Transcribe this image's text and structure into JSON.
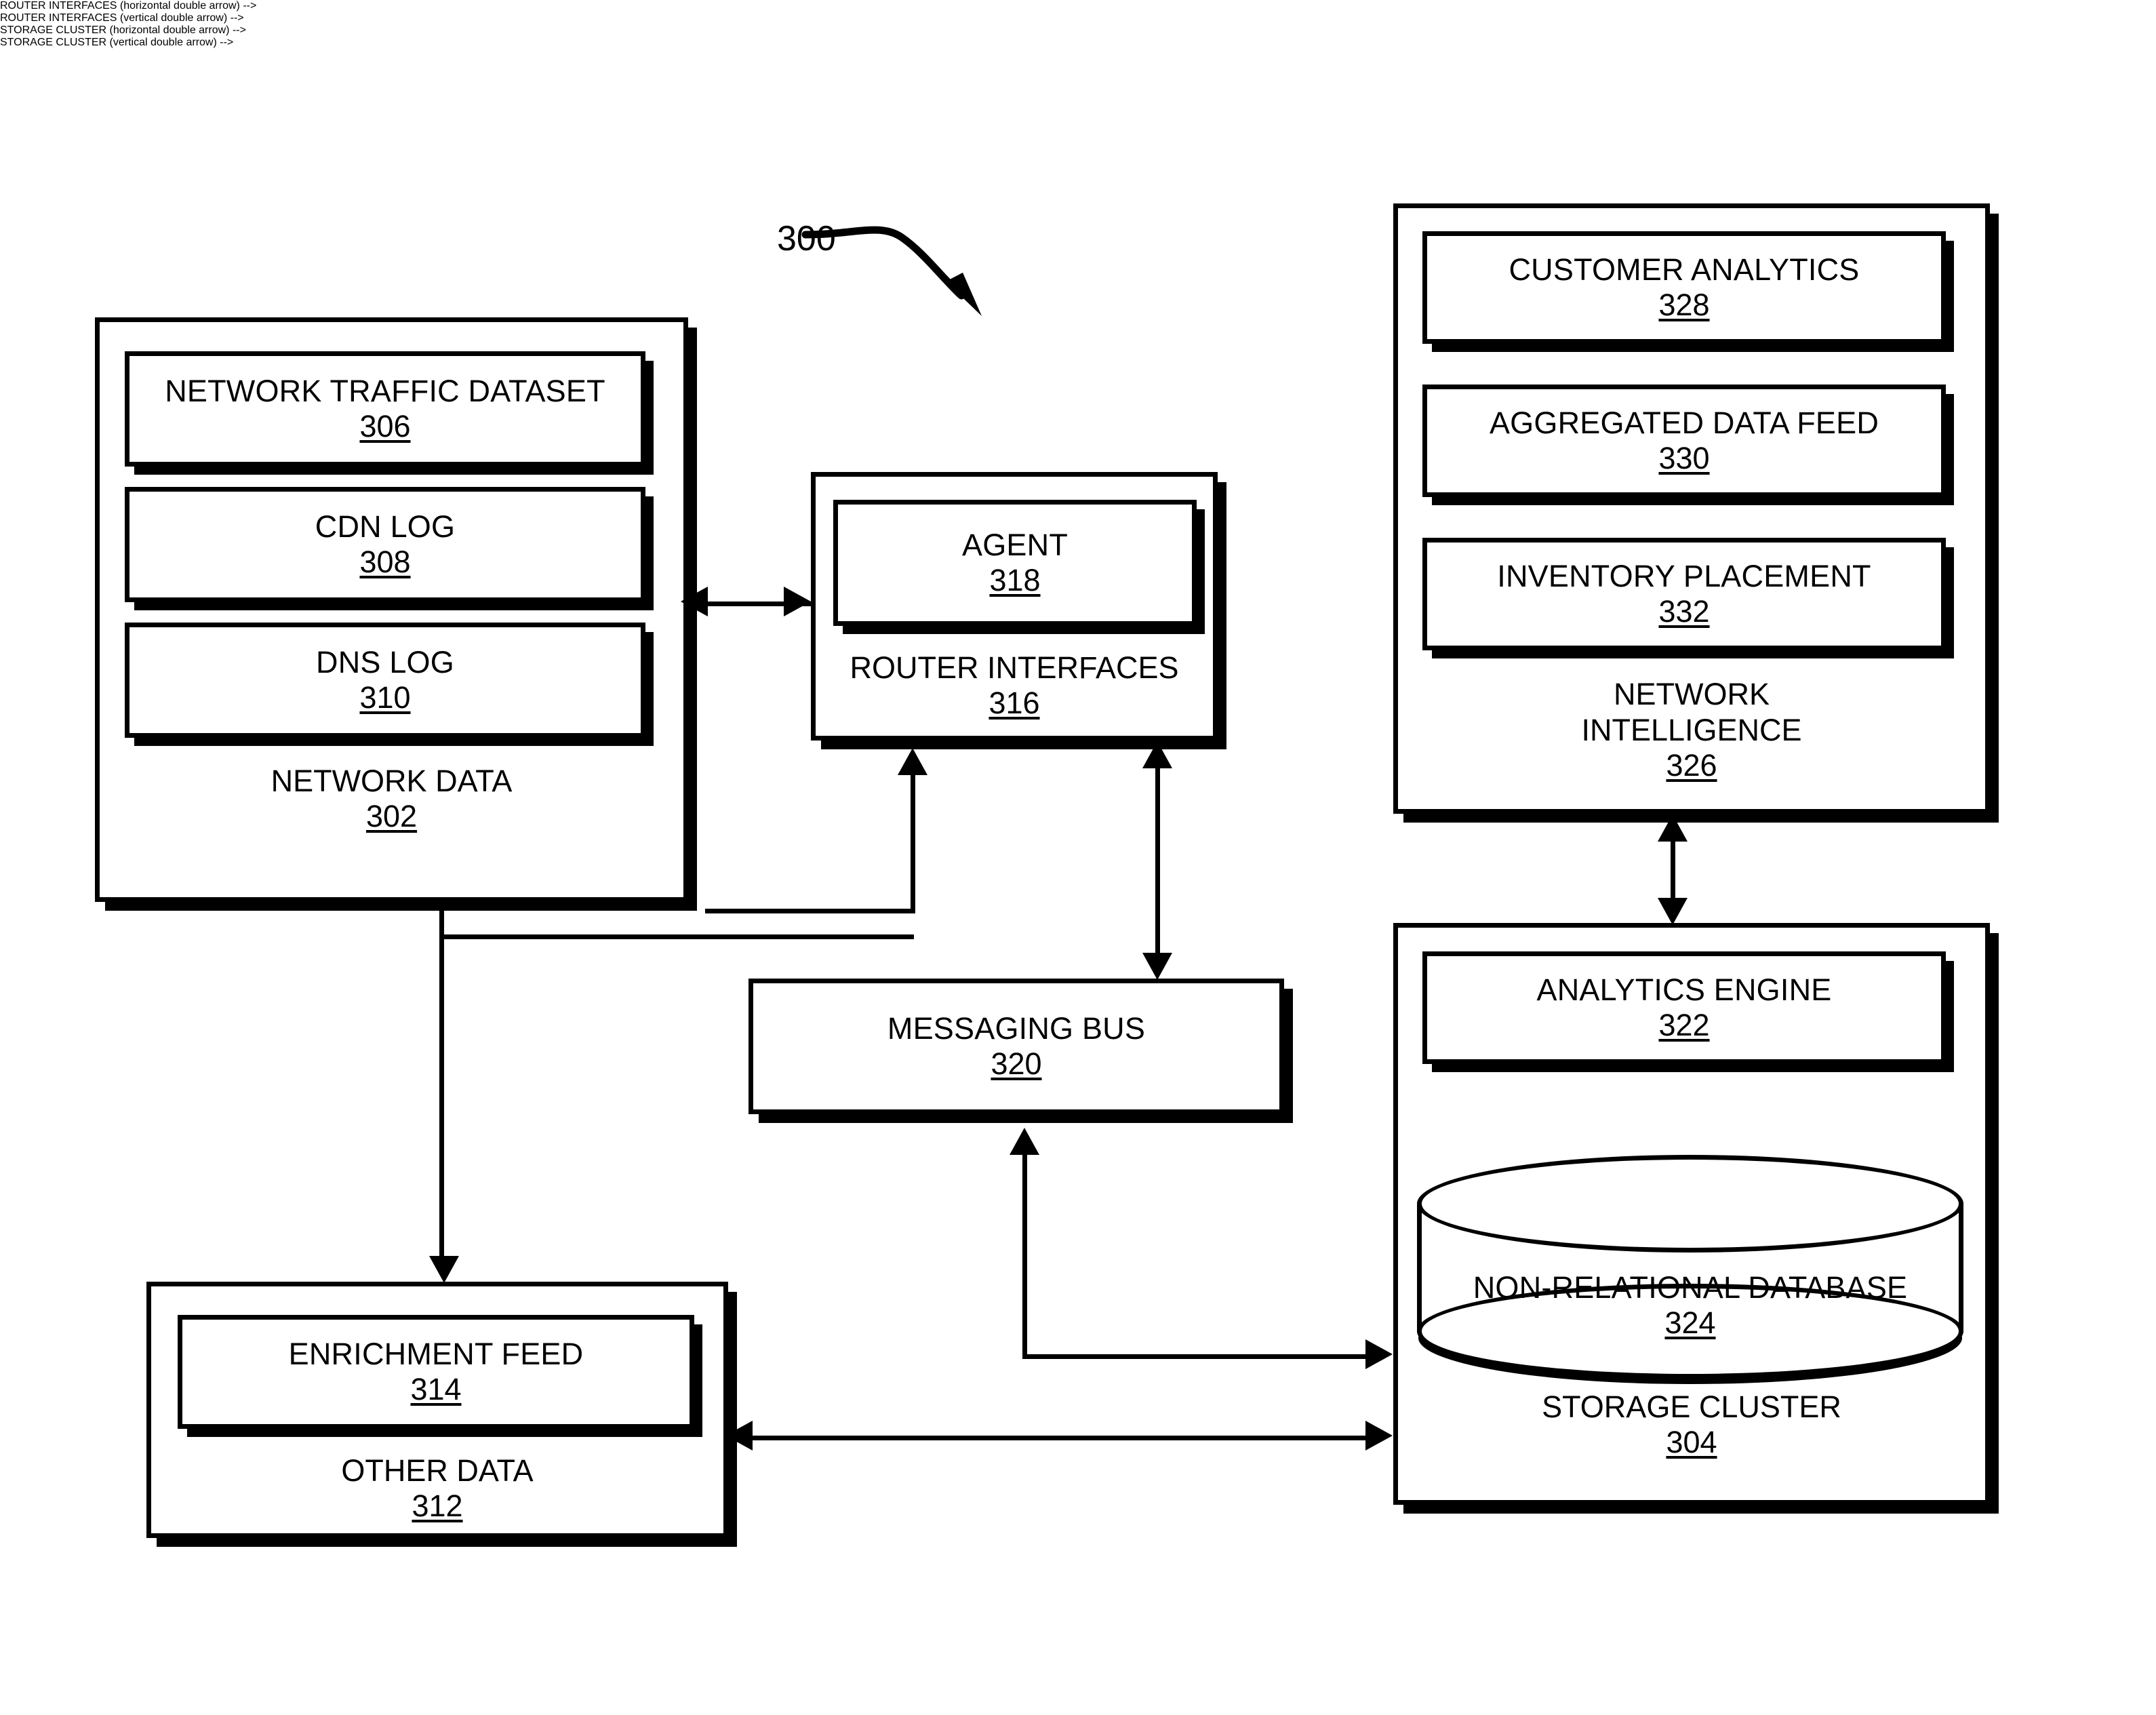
{
  "figure": {
    "number": "300",
    "pointer_icon": "curved-arrow-icon"
  },
  "network_data": {
    "caption": "NETWORK DATA",
    "ref": "302",
    "items": [
      {
        "label": "NETWORK TRAFFIC DATASET",
        "ref": "306"
      },
      {
        "label": "CDN LOG",
        "ref": "308"
      },
      {
        "label": "DNS LOG",
        "ref": "310"
      }
    ]
  },
  "router_interfaces": {
    "caption": "ROUTER INTERFACES",
    "ref": "316",
    "items": [
      {
        "label": "AGENT",
        "ref": "318"
      }
    ]
  },
  "messaging_bus": {
    "label": "MESSAGING BUS",
    "ref": "320"
  },
  "other_data": {
    "caption": "OTHER DATA",
    "ref": "312",
    "items": [
      {
        "label": "ENRICHMENT FEED",
        "ref": "314"
      }
    ]
  },
  "network_intelligence": {
    "caption_line1": "NETWORK",
    "caption_line2": "INTELLIGENCE",
    "ref": "326",
    "items": [
      {
        "label": "CUSTOMER ANALYTICS",
        "ref": "328"
      },
      {
        "label": "AGGREGATED DATA FEED",
        "ref": "330"
      },
      {
        "label": "INVENTORY PLACEMENT",
        "ref": "332"
      }
    ]
  },
  "storage_cluster": {
    "caption": "STORAGE CLUSTER",
    "ref": "304",
    "items": [
      {
        "label": "ANALYTICS ENGINE",
        "ref": "322"
      }
    ],
    "database": {
      "label": "NON-RELATIONAL DATABASE",
      "ref": "324"
    }
  },
  "connectors": [
    {
      "name": "network-data-to-router-interfaces",
      "style": "double-arrow-horizontal"
    },
    {
      "name": "network-data-to-other-data",
      "style": "elbow-arrow-down"
    },
    {
      "name": "messaging-bus-to-router-interfaces",
      "style": "double-arrow-vertical"
    },
    {
      "name": "storage-cluster-to-router-interfaces",
      "style": "elbow-arrow-up"
    },
    {
      "name": "storage-cluster-to-messaging-bus",
      "style": "elbow-arrow-up"
    },
    {
      "name": "messaging-bus-to-storage-cluster",
      "style": "elbow-arrow-right"
    },
    {
      "name": "other-data-to-storage-cluster",
      "style": "double-arrow-horizontal"
    },
    {
      "name": "storage-cluster-to-network-intelligence",
      "style": "double-arrow-vertical"
    }
  ],
  "colors": {
    "stroke": "#000000",
    "background": "#ffffff"
  }
}
